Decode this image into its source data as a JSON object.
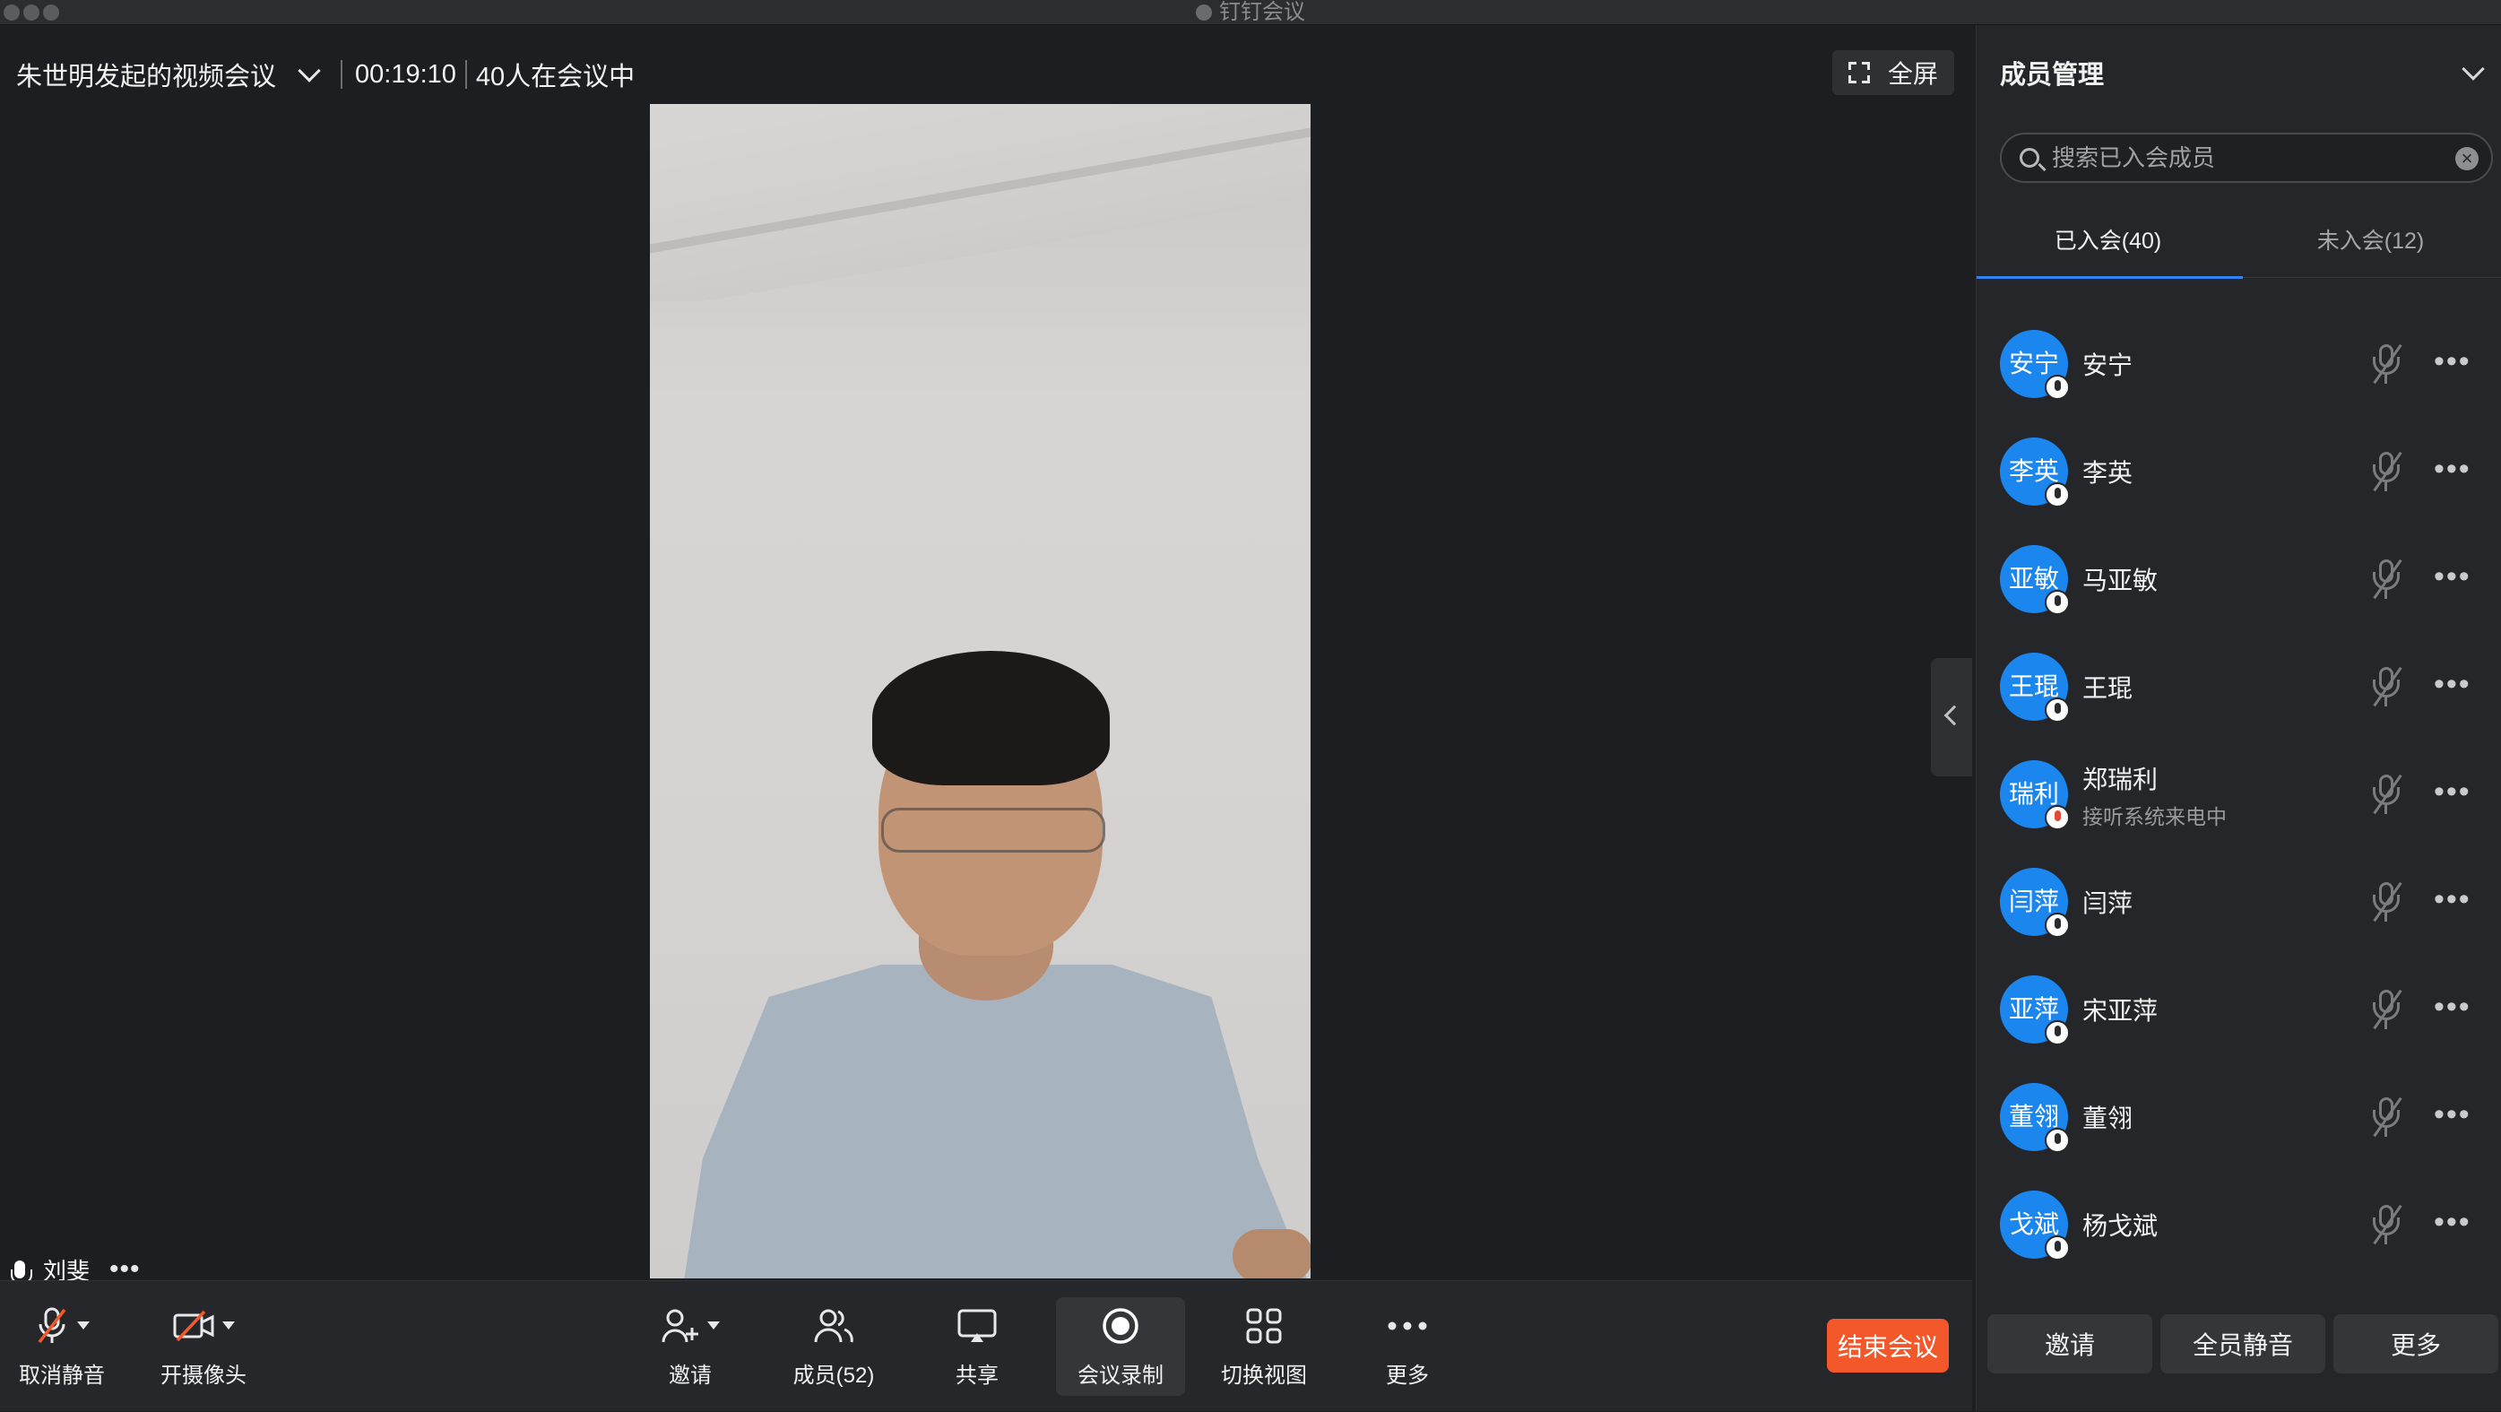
{
  "window": {
    "title": "钉钉会议"
  },
  "header": {
    "meeting_title": "朱世明发起的视频会议",
    "elapsed": "00:19:10",
    "attendance": "40人在会议中",
    "fullscreen_label": "全屏"
  },
  "video": {
    "speaker_name": "刘斐"
  },
  "toolbar": {
    "unmute_label": "取消静音",
    "camera_label": "开摄像头",
    "invite_label": "邀请",
    "members_label": "成员(52)",
    "share_label": "共享",
    "record_label": "会议录制",
    "view_label": "切换视图",
    "more_label": "更多",
    "end_label": "结束会议"
  },
  "panel": {
    "title": "成员管理",
    "search_placeholder": "搜索已入会成员",
    "tab_joined": "已入会(40)",
    "tab_not_joined": "未入会(12)",
    "members": [
      {
        "avatar": "安宁",
        "name": "安宁",
        "status": ""
      },
      {
        "avatar": "李英",
        "name": "李英",
        "status": ""
      },
      {
        "avatar": "亚敏",
        "name": "马亚敏",
        "status": ""
      },
      {
        "avatar": "王琨",
        "name": "王琨",
        "status": ""
      },
      {
        "avatar": "瑞利",
        "name": "郑瑞利",
        "status": "接听系统来电中"
      },
      {
        "avatar": "闫萍",
        "name": "闫萍",
        "status": ""
      },
      {
        "avatar": "亚萍",
        "name": "宋亚萍",
        "status": ""
      },
      {
        "avatar": "董翎",
        "name": "董翎",
        "status": ""
      },
      {
        "avatar": "戈斌",
        "name": "杨戈斌",
        "status": ""
      }
    ],
    "footer_invite": "邀请",
    "footer_mute_all": "全员静音",
    "footer_more": "更多"
  },
  "colors": {
    "accent": "#2f83f5",
    "avatar": "#1a86ee",
    "end_button": "#f3582b"
  }
}
